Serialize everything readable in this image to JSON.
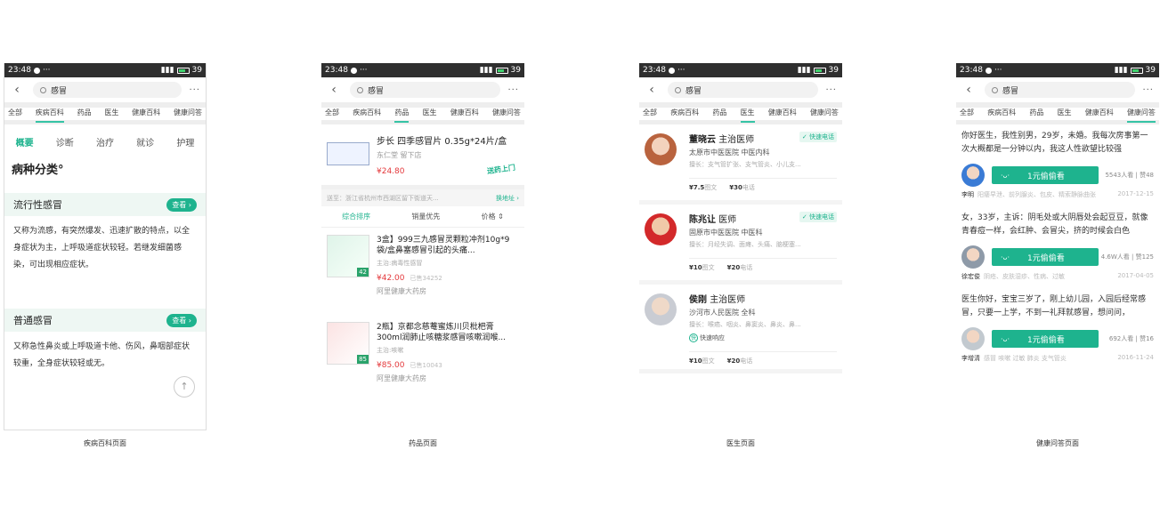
{
  "status": {
    "time": "23:48",
    "battery": "39"
  },
  "search": {
    "query": "感冒"
  },
  "tabs": [
    "全部",
    "疾病百科",
    "药品",
    "医生",
    "健康百科",
    "健康问答"
  ],
  "page1": {
    "caption": "疾病百科页面",
    "subtabs": [
      "概要",
      "诊断",
      "治疗",
      "就诊",
      "护理"
    ],
    "heading": "病种分类°",
    "sections": [
      {
        "title": "流行性感冒",
        "btn": "查看",
        "text": "又称为流感，有突然爆发、迅速扩散的特点，以全身症状为主，上呼吸道症状较轻。若继发细菌感染，可出现相应症状。"
      },
      {
        "title": "普通感冒",
        "btn": "查看",
        "text": "又称急性鼻炎或上呼吸道卡他、伤风，鼻咽部症状较重，全身症状较轻或无。"
      }
    ]
  },
  "page2": {
    "caption": "药品页面",
    "top": {
      "name": "步长 四季感冒片 0.35g*24片/盒",
      "shop": "东仁堂 留下店",
      "price": "¥24.80",
      "badge": "送药上门"
    },
    "address": {
      "text": "送至：浙江省杭州市西湖区留下街道天...",
      "change": "换地址"
    },
    "sort": [
      "综合排序",
      "销量优先",
      "价格"
    ],
    "items": [
      {
        "name": "3盒】999三九感冒灵颗粒冲剂10g*9袋/盒鼻塞感冒引起的头痛...",
        "sub": "主治:病毒性感冒",
        "price": "¥42.00",
        "sold": "已售34252",
        "shop": "阿里健康大药房",
        "tag": "42"
      },
      {
        "name": "2瓶】京都念慈菴蜜炼川贝枇杷膏300ml润肺止咳糖浆感冒咳嗽润喉...",
        "sub": "主治:咳嗽",
        "price": "¥85.00",
        "sold": "已售10043",
        "shop": "阿里健康大药房",
        "tag": "85"
      }
    ]
  },
  "page3": {
    "caption": "医生页面",
    "doctors": [
      {
        "name": "董晓云",
        "title": "主治医师",
        "hospital": "太原市中医医院",
        "dept": "中医内科",
        "skill": "擅长：支气管扩张、支气管炎、小儿支...",
        "p1": "¥7.5",
        "p1l": "图文",
        "p2": "¥30",
        "p2l": "电话",
        "quick": "快速电话",
        "avatarColor": "#b9633e"
      },
      {
        "name": "陈兆让",
        "title": "医师",
        "hospital": "固原市中医医院",
        "dept": "中医科",
        "skill": "擅长：月经失调、面瘫、头痛、脑梗塞...",
        "p1": "¥10",
        "p1l": "图文",
        "p2": "¥20",
        "p2l": "电话",
        "quick": "快速电话",
        "avatarColor": "#d3292a"
      },
      {
        "name": "侯刚",
        "title": "主治医师",
        "hospital": "沙河市人民医院",
        "dept": "全科",
        "skill": "擅长：喉癌、咽炎、鼻窦炎、鼻炎、鼻...",
        "resp": "快速响应",
        "p1": "¥10",
        "p1l": "图文",
        "p2": "¥20",
        "p2l": "电话",
        "avatarColor": "#c9ccd3"
      }
    ]
  },
  "page4": {
    "caption": "健康问答页面",
    "listen_label": "1元偷偷看",
    "qas": [
      {
        "q": "你好医生，我性别男，29岁，未婚。我每次房事第一次大概都是一分钟以内，我这人性欲望比较强",
        "views": "5543人看",
        "likes": "赞48",
        "doctor": "李明",
        "tags": "阳痿早泄、前列腺炎、包皮、精索静脉曲张",
        "date": "2017-12-15",
        "avatarColor": "#3a7bd5"
      },
      {
        "q": "女，33岁，主诉：阴毛处或大阴唇处会起豆豆，就像青春痘一样，会红肿、会冒尖，挤的时候会白色",
        "views": "4.6W人看",
        "likes": "赞125",
        "doctor": "徐宏俊",
        "tags": "阴疮、皮肤湿疹、性病、过敏",
        "date": "2017-04-05",
        "avatarColor": "#8e9aa8"
      },
      {
        "q": "医生你好，宝宝三岁了，刚上幼儿园，入园后经常感冒，只要一上学，不到一礼拜就感冒，想问问，",
        "views": "692人看",
        "likes": "赞16",
        "doctor": "李增清",
        "tags": "感冒 咳嗽 过敏 肺炎 支气管炎",
        "date": "2016-11-24",
        "avatarColor": "#c2c9cf"
      }
    ]
  }
}
